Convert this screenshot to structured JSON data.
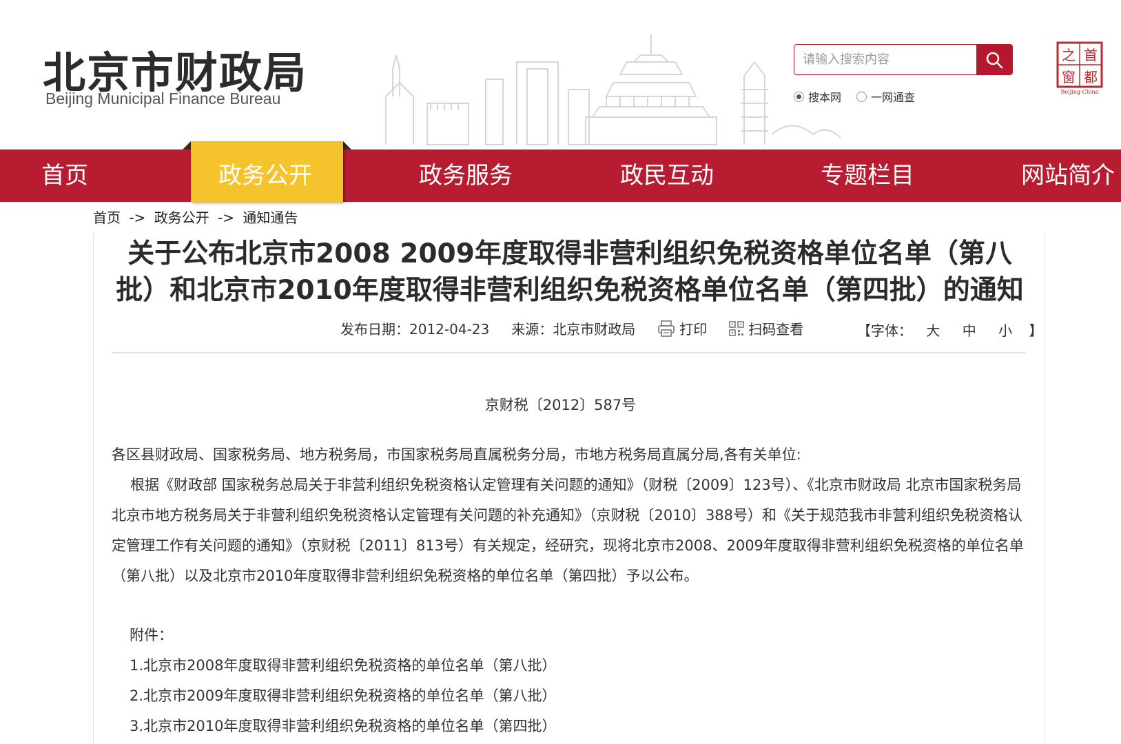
{
  "header": {
    "logo_cn": "北京市财政局",
    "logo_en": "Beijing Municipal Finance Bureau",
    "search_placeholder": "请输入搜索内容",
    "search_options": [
      "搜本网",
      "一网通查"
    ],
    "capital_logo_text": [
      "之",
      "首",
      "窗",
      "都"
    ],
    "capital_logo_sub": "Beijing-China"
  },
  "nav": {
    "items": [
      "首页",
      "政务公开",
      "政务服务",
      "政民互动",
      "专题栏目",
      "网站简介"
    ]
  },
  "breadcrumb": [
    "首页",
    "->",
    "政务公开",
    "->",
    "通知通告"
  ],
  "article": {
    "title": "关于公布北京市2008 2009年度取得非营利组织免税资格单位名单（第八批）和北京市2010年度取得非营利组织免税资格单位名单（第四批）的通知",
    "date": "发布日期：2012-04-23",
    "source": "来源：北京市财政局",
    "print": "打印",
    "qrcode": "扫码查看",
    "font_label": "【字体：",
    "font_sizes": [
      "大",
      "中",
      "小"
    ],
    "font_close": "】",
    "doc_number": "京财税〔2012〕587号",
    "salutation": "各区县财政局、国家税务局、地方税务局，市国家税务局直属税务分局，市地方税务局直属分局,各有关单位:",
    "paragraph": "根据《财政部 国家税务总局关于非营利组织免税资格认定管理有关问题的通知》（财税〔2009〕123号）、《北京市财政局 北京市国家税务局 北京市地方税务局关于非营利组织免税资格认定管理有关问题的补充通知》（京财税〔2010〕388号）和《关于规范我市非营利组织免税资格认定管理工作有关问题的通知》（京财税〔2011〕813号）有关规定，经研究，现将北京市2008、2009年度取得非营利组织免税资格的单位名单（第八批）以及北京市2010年度取得非营利组织免税资格的单位名单（第四批）予以公布。",
    "attachments_label": "附件：",
    "attachments": [
      "1.北京市2008年度取得非营利组织免税资格的单位名单（第八批）",
      "2.北京市2009年度取得非营利组织免税资格的单位名单（第八批）",
      "3.北京市2010年度取得非营利组织免税资格的单位名单（第四批）"
    ]
  },
  "colors": {
    "brand_red": "#b71c30",
    "nav_active": "#f5c32c"
  }
}
